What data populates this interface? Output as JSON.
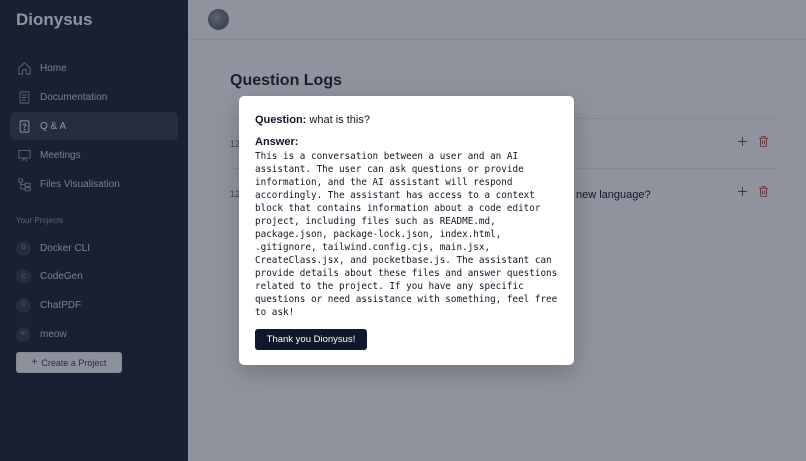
{
  "app": {
    "brand": "Dionysus"
  },
  "sidebar": {
    "nav": [
      {
        "label": "Home",
        "icon": "home-icon"
      },
      {
        "label": "Documentation",
        "icon": "document-icon"
      },
      {
        "label": "Q & A",
        "icon": "question-icon",
        "active": true
      },
      {
        "label": "Meetings",
        "icon": "presentation-icon"
      },
      {
        "label": "Files Visualisation",
        "icon": "tree-icon"
      }
    ],
    "projects_label": "Your Projects",
    "projects": [
      {
        "initial": "D",
        "name": "Docker CLI"
      },
      {
        "initial": "C",
        "name": "CodeGen"
      },
      {
        "initial": "C",
        "name": "ChatPDF"
      },
      {
        "initial": "m",
        "name": "meow"
      }
    ],
    "create_label": "Create a Project"
  },
  "main": {
    "title": "Question Logs",
    "logs": [
      {
        "date": "12",
        "question": ""
      },
      {
        "date": "12",
        "question": "new language?"
      }
    ]
  },
  "modal": {
    "question_label": "Question:",
    "question": "what is this?",
    "answer_label": "Answer:",
    "answer": "This is a conversation between a user and an AI assistant. The user can ask questions or provide information, and the AI assistant will respond accordingly. The assistant has access to a context block that contains information about a code editor project, including files such as README.md, package.json, package-lock.json, index.html, .gitignore, tailwind.config.cjs, main.jsx, CreateClass.jsx, and pocketbase.js. The assistant can provide details about these files and answer questions related to the project. If you have any specific questions or need assistance with something, feel free to ask!",
    "button_label": "Thank you Dionysus!"
  },
  "colors": {
    "sidebar": "#1f2937",
    "accent": "#0f172a",
    "delete": "#dc2626"
  }
}
